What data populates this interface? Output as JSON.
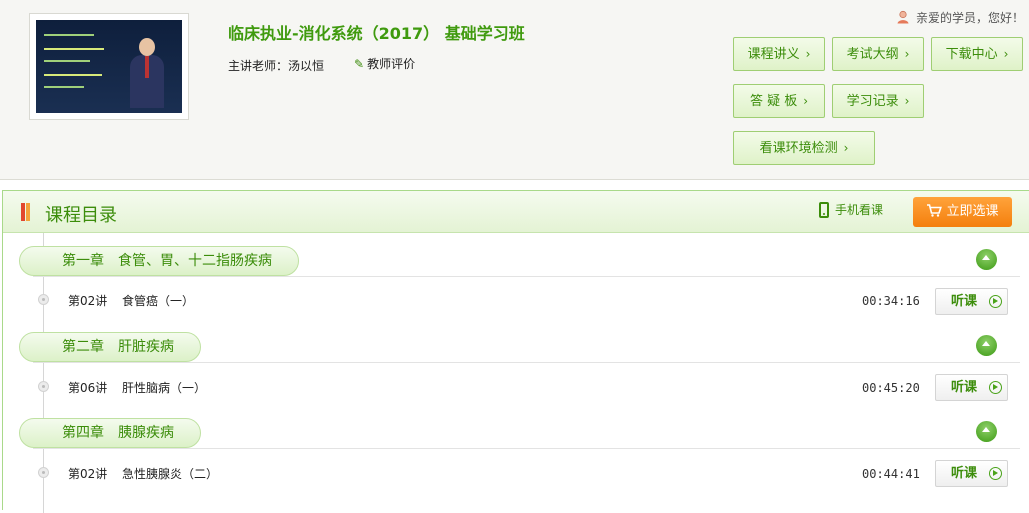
{
  "course": {
    "title": "临床执业-消化系统（2017） 基础学习班",
    "teacher": "主讲老师：汤以恒",
    "rate_label": "教师评价"
  },
  "user": {
    "greeting": "亲爱的学员，您好！"
  },
  "nav_buttons": [
    {
      "label": "课程讲义"
    },
    {
      "label": "考试大纲"
    },
    {
      "label": "下载中心"
    },
    {
      "label": "答 疑 板"
    },
    {
      "label": "学习记录"
    },
    {
      "label": "看课环境检测"
    }
  ],
  "catalog": {
    "title": "课程目录",
    "mobile_label": "手机看课",
    "buy_label": "立即选课",
    "chapters": [
      {
        "name": "第一章　食管、胃、十二指肠疾病",
        "lessons": [
          {
            "no": "第02讲",
            "name": "食管癌（一）",
            "time": "00:34:16",
            "action": "听课"
          }
        ]
      },
      {
        "name": "第二章　肝脏疾病",
        "lessons": [
          {
            "no": "第06讲",
            "name": "肝性脑病（一）",
            "time": "00:45:20",
            "action": "听课"
          }
        ]
      },
      {
        "name": "第四章　胰腺疾病",
        "lessons": [
          {
            "no": "第02讲",
            "name": "急性胰腺炎（二）",
            "time": "00:44:41",
            "action": "听课"
          }
        ]
      }
    ]
  },
  "colors": {
    "accent_green": "#3c8d0b",
    "buy_orange": "#f47f0d"
  },
  "icons": {
    "arrow": "chevron-right-icon",
    "rate": "pencil-icon",
    "user": "user-icon",
    "mobile": "phone-icon",
    "buy": "cart-icon",
    "collapse": "collapse-up-icon",
    "play": "play-icon"
  }
}
